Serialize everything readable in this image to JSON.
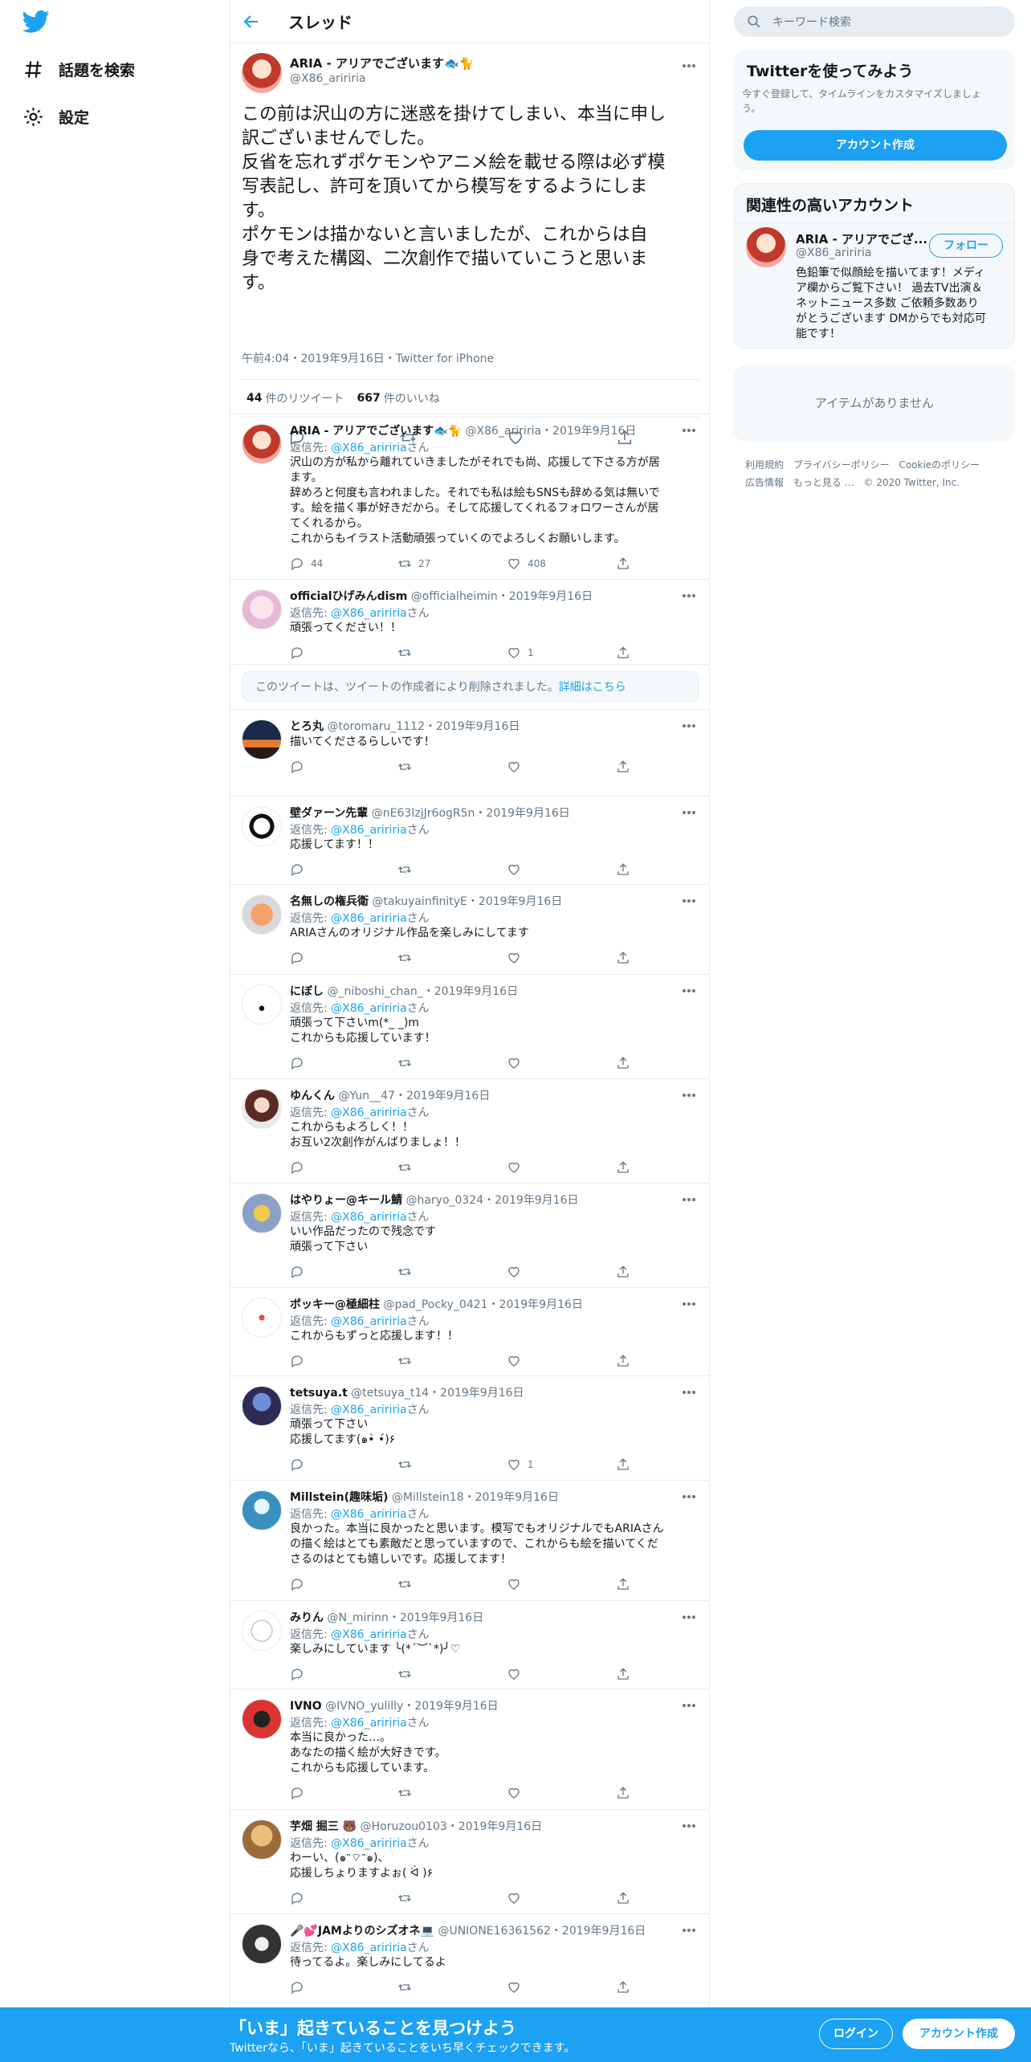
{
  "nav": {
    "items": [
      {
        "label": "話題を検索"
      },
      {
        "label": "設定"
      }
    ]
  },
  "header": {
    "title": "スレッド"
  },
  "main_tweet": {
    "name": "ARIA - アリアでございます🐟🐈",
    "handle": "@X86_aririria",
    "text_lines": [
      "この前は沢山の方に迷惑を掛けてしまい、本当に申し",
      "訳ございませんでした。",
      "反省を忘れずポケモンやアニメ絵を載せる際は必ず模",
      "写表記し、許可を頂いてから模写をするようにしま",
      "す。",
      "ポケモンは描かないと言いましたが、これからは自",
      "身で考えた構図、二次創作で描いていこうと思いま",
      "す。"
    ],
    "meta": "午前4:04・2019年9月16日・Twitter for iPhone",
    "retweets": "44",
    "retweets_label": "件のリツイート",
    "likes": "667",
    "likes_label": "件のいいね"
  },
  "replies": [
    {
      "name": "ARIA - アリアでございます🐟🐈",
      "handle": "@X86_aririria",
      "date": "2019年9月16日",
      "reply_to": "@X86_aririria",
      "text": [
        "沢山の方が私から離れていきましたがそれでも尚、応援して下さる方が居",
        "ます。",
        "辞めろと何度も言われました。それでも私は絵もSNSも辞める気は無いで",
        "す。絵を描く事が好きだから。そして応援してくれるフォロワーさんが居",
        "てくれるから。",
        "これからもイラスト活動頑張っていくのでよろしくお願いします。"
      ],
      "replies_count": "44",
      "rts": "27",
      "likes": "408"
    },
    {
      "name": "officialひげみんdism",
      "handle": "@officialheimin",
      "date": "2019年9月16日",
      "reply_to": "@X86_aririria",
      "text": [
        "頑張ってください！！"
      ],
      "replies_count": "",
      "rts": "",
      "likes": "1"
    },
    {
      "name": "とろ丸",
      "handle": "@toromaru_1112",
      "date": "2019年9月16日",
      "reply_to": "",
      "text": [
        "描いてくださるらしいです！"
      ],
      "replies_count": "",
      "rts": "",
      "likes": ""
    },
    {
      "name": "壁ダァーン先輩",
      "handle": "@nE63IzjJr6ogR5n",
      "date": "2019年9月16日",
      "reply_to": "@X86_aririria",
      "text": [
        "応援してます！！"
      ],
      "replies_count": "",
      "rts": "",
      "likes": ""
    },
    {
      "name": "名無しの権兵衛",
      "handle": "@takuyainfinityE",
      "date": "2019年9月16日",
      "reply_to": "@X86_aririria",
      "text": [
        "ARIAさんのオリジナル作品を楽しみにしてます"
      ],
      "replies_count": "",
      "rts": "",
      "likes": ""
    },
    {
      "name": "にぼし",
      "handle": "@_niboshi_chan_",
      "date": "2019年9月16日",
      "reply_to": "@X86_aririria",
      "text": [
        "頑張って下さいm(*_ _)m",
        "これからも応援しています！"
      ],
      "replies_count": "",
      "rts": "",
      "likes": ""
    },
    {
      "name": "ゆんくん",
      "handle": "@Yun__47",
      "date": "2019年9月16日",
      "reply_to": "@X86_aririria",
      "text": [
        "これからもよろしく！！",
        "お互い2次創作がんばりましょ！！"
      ],
      "replies_count": "",
      "rts": "",
      "likes": ""
    },
    {
      "name": "はやりょー@キール鯖",
      "handle": "@haryo_0324",
      "date": "2019年9月16日",
      "reply_to": "@X86_aririria",
      "text": [
        "いい作品だったので残念です",
        "頑張って下さい"
      ],
      "replies_count": "",
      "rts": "",
      "likes": ""
    },
    {
      "name": "ポッキー@極細柱",
      "handle": "@pad_Pocky_0421",
      "date": "2019年9月16日",
      "reply_to": "@X86_aririria",
      "text": [
        "これからもずっと応援します！！"
      ],
      "replies_count": "",
      "rts": "",
      "likes": ""
    },
    {
      "name": "tetsuya.t",
      "handle": "@tetsuya_t14",
      "date": "2019年9月16日",
      "reply_to": "@X86_aririria",
      "text": [
        "頑張って下さい",
        "応援してます(๑•̀ •́)۶"
      ],
      "replies_count": "",
      "rts": "",
      "likes": "1"
    },
    {
      "name": "Millstein(趣味垢)",
      "handle": "@Millstein18",
      "date": "2019年9月16日",
      "reply_to": "@X86_aririria",
      "text": [
        "良かった。本当に良かったと思います。模写でもオリジナルでもARIAさん",
        "の描く絵はとても素敵だと思っていますので、これからも絵を描いてくだ",
        "さるのはとても嬉しいです。応援してます！"
      ],
      "replies_count": "",
      "rts": "",
      "likes": ""
    },
    {
      "name": "みりん",
      "handle": "@N_mirinn",
      "date": "2019年9月16日",
      "reply_to": "@X86_aririria",
      "text": [
        "楽しみにしています ╰(*´︶`*)╯♡"
      ],
      "replies_count": "",
      "rts": "",
      "likes": ""
    },
    {
      "name": "IVNO",
      "handle": "@IVNO_yulilly",
      "date": "2019年9月16日",
      "reply_to": "@X86_aririria",
      "text": [
        "本当に良かった…。",
        "あなたの描く絵が大好きです。",
        "これからも応援しています。"
      ],
      "replies_count": "",
      "rts": "",
      "likes": ""
    },
    {
      "name": "芋畑 掘三 🐻",
      "handle": "@Horuzou0103",
      "date": "2019年9月16日",
      "reply_to": "@X86_aririria",
      "text": [
        "わーい、(๑ᵔ⌔ᵔ๑)、",
        "応援しちょりますよぉ( ᐛ )۶"
      ],
      "replies_count": "",
      "rts": "",
      "likes": ""
    },
    {
      "name": "🎤💕JAMよりのシズオネ💻",
      "handle": "@UNIONE16361562",
      "date": "2019年9月16日",
      "reply_to": "@X86_aririria",
      "text": [
        "待ってるよ。楽しみにしてるよ"
      ],
      "replies_count": "",
      "rts": "",
      "likes": ""
    }
  ],
  "reply_label_prefix": "返信先:",
  "reply_label_suffix": "さん",
  "deleted_notice": {
    "text": "このツイートは、ツイートの作成者により削除されました。",
    "link": "詳細はこちら"
  },
  "right": {
    "search_placeholder": "キーワード検索",
    "signup_card": {
      "title": "Twitterを使ってみよう",
      "body_lines": [
        "今すぐ登録して、タイムラインをカスタマイズしましょ",
        "う。"
      ],
      "button": "アカウント作成"
    },
    "related_card": {
      "title": "関連性の高いアカウント",
      "name": "ARIA - アリアでござ...",
      "handle": "@X86_aririria",
      "follow": "フォロー",
      "bio_lines": [
        "色鉛筆で似顔絵を描いてます！メディ",
        "ア欄からご覧下さい！ 過去TV出演＆",
        "ネットニュース多数 ご依頼多数あり",
        "がとうございます DMからでも対応可",
        "能です！"
      ]
    },
    "empty_card": "アイテムがありません",
    "footer": [
      "利用規約",
      "プライバシーポリシー",
      "Cookieのポリシー",
      "広告情報",
      "もっと見る …",
      "© 2020 Twitter, Inc."
    ]
  },
  "bottom": {
    "title": "「いま」起きていることを見つけよう",
    "subtitle": "Twitterなら、「いま」起きていることをいち早くチェックできます。",
    "login": "ログイン",
    "signup": "アカウント作成"
  },
  "colors": {
    "brand": "#1da1f2",
    "text": "#14171a",
    "secondary": "#657786",
    "border": "#e6ecf0"
  }
}
